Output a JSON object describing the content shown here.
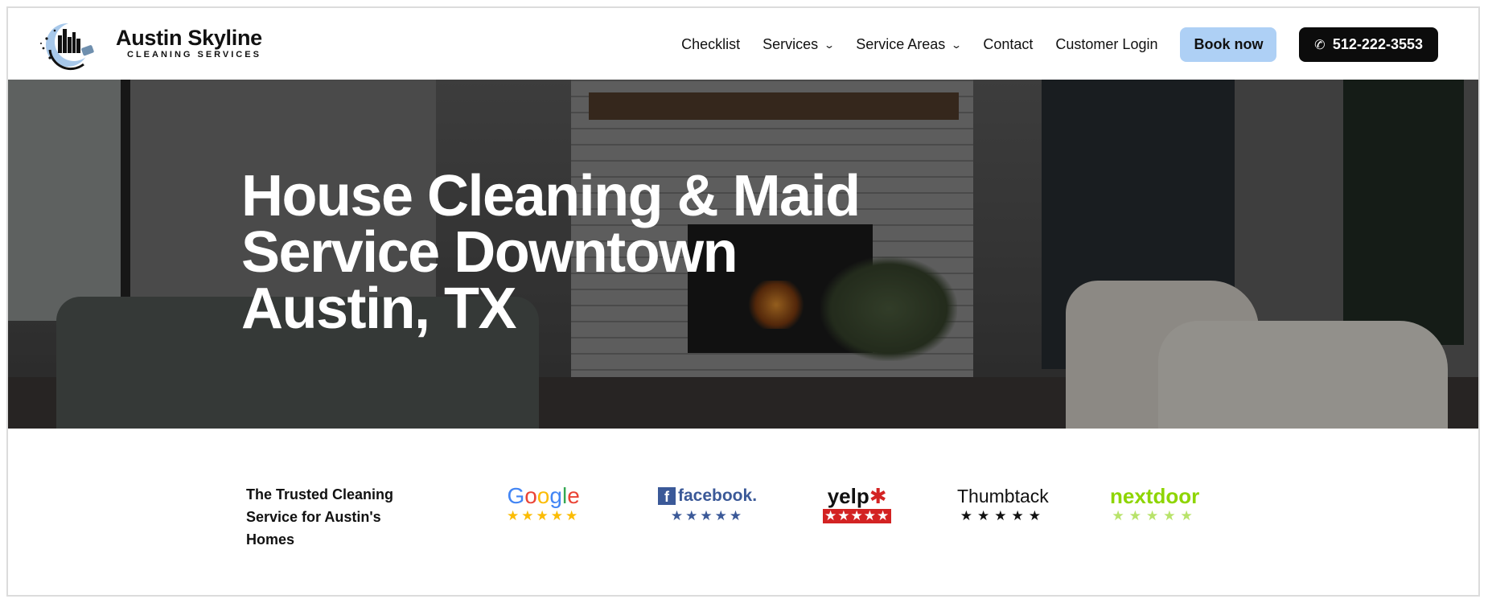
{
  "header": {
    "brand_name": "Austin Skyline",
    "brand_sub": "CLEANING SERVICES",
    "nav": [
      {
        "label": "Checklist",
        "dropdown": false
      },
      {
        "label": "Services",
        "dropdown": true
      },
      {
        "label": "Service Areas",
        "dropdown": true
      },
      {
        "label": "Contact",
        "dropdown": false
      },
      {
        "label": "Customer Login",
        "dropdown": false
      }
    ],
    "book_label": "Book now",
    "phone_label": "512-222-3553"
  },
  "hero": {
    "title_line1": "House Cleaning & Maid",
    "title_line2": "Service Downtown",
    "title_line3": "Austin, TX"
  },
  "trust": {
    "text": "The Trusted Cleaning Service for Austin's Homes",
    "badges": [
      {
        "name": "Google",
        "stars": "★★★★★",
        "color": "#fbbc04"
      },
      {
        "name": "facebook.",
        "stars": "★★★★★",
        "color": "#3b5998"
      },
      {
        "name": "yelp",
        "stars": "★★★★★",
        "color": "#d32323"
      },
      {
        "name": "Thumbtack",
        "stars": "★★★★★",
        "color": "#111111"
      },
      {
        "name": "nextdoor",
        "stars": "★★★★★",
        "color": "#8ed500"
      }
    ]
  },
  "colors": {
    "book_button_bg": "#aed0f5",
    "phone_button_bg": "#0c0c0c",
    "logo_accent": "#a7c8ea"
  },
  "icons": {
    "chevron": "chevron-down-icon",
    "phone": "phone-icon"
  }
}
